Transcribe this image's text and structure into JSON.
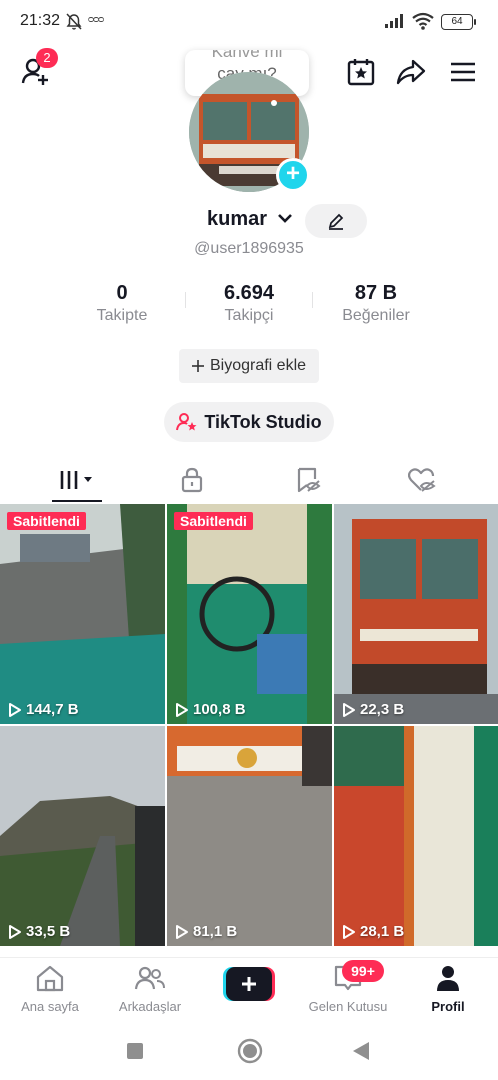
{
  "status_bar": {
    "time": "21:32",
    "battery": "64"
  },
  "header": {
    "add_friends_badge": "2",
    "tooltip_line1": "Kahve mi",
    "tooltip_line2": "çay mı?"
  },
  "profile": {
    "name": "kumar",
    "handle": "@user1896935",
    "stats": [
      {
        "value": "0",
        "label": "Takipte"
      },
      {
        "value": "6.694",
        "label": "Takipçi"
      },
      {
        "value": "87 B",
        "label": "Beğeniler"
      }
    ],
    "bio_button": "Biyografi ekle",
    "studio_button": "TikTok Studio"
  },
  "tabs": [
    "videos-grid",
    "private",
    "reposts",
    "liked"
  ],
  "videos": [
    {
      "views": "144,7 B",
      "pinned": "Sabitlendi"
    },
    {
      "views": "100,8 B",
      "pinned": "Sabitlendi"
    },
    {
      "views": "22,3 B",
      "pinned": ""
    },
    {
      "views": "33,5 B",
      "pinned": ""
    },
    {
      "views": "81,1 B",
      "pinned": ""
    },
    {
      "views": "28,1 B",
      "pinned": ""
    }
  ],
  "bottom_nav": {
    "home": "Ana sayfa",
    "friends": "Arkadaşlar",
    "inbox": "Gelen Kutusu",
    "inbox_badge": "99+",
    "profile": "Profil"
  },
  "colors": {
    "accent_red": "#fe2c55",
    "accent_cyan": "#20d5ec",
    "text": "#161823",
    "muted": "#8a8b91"
  }
}
